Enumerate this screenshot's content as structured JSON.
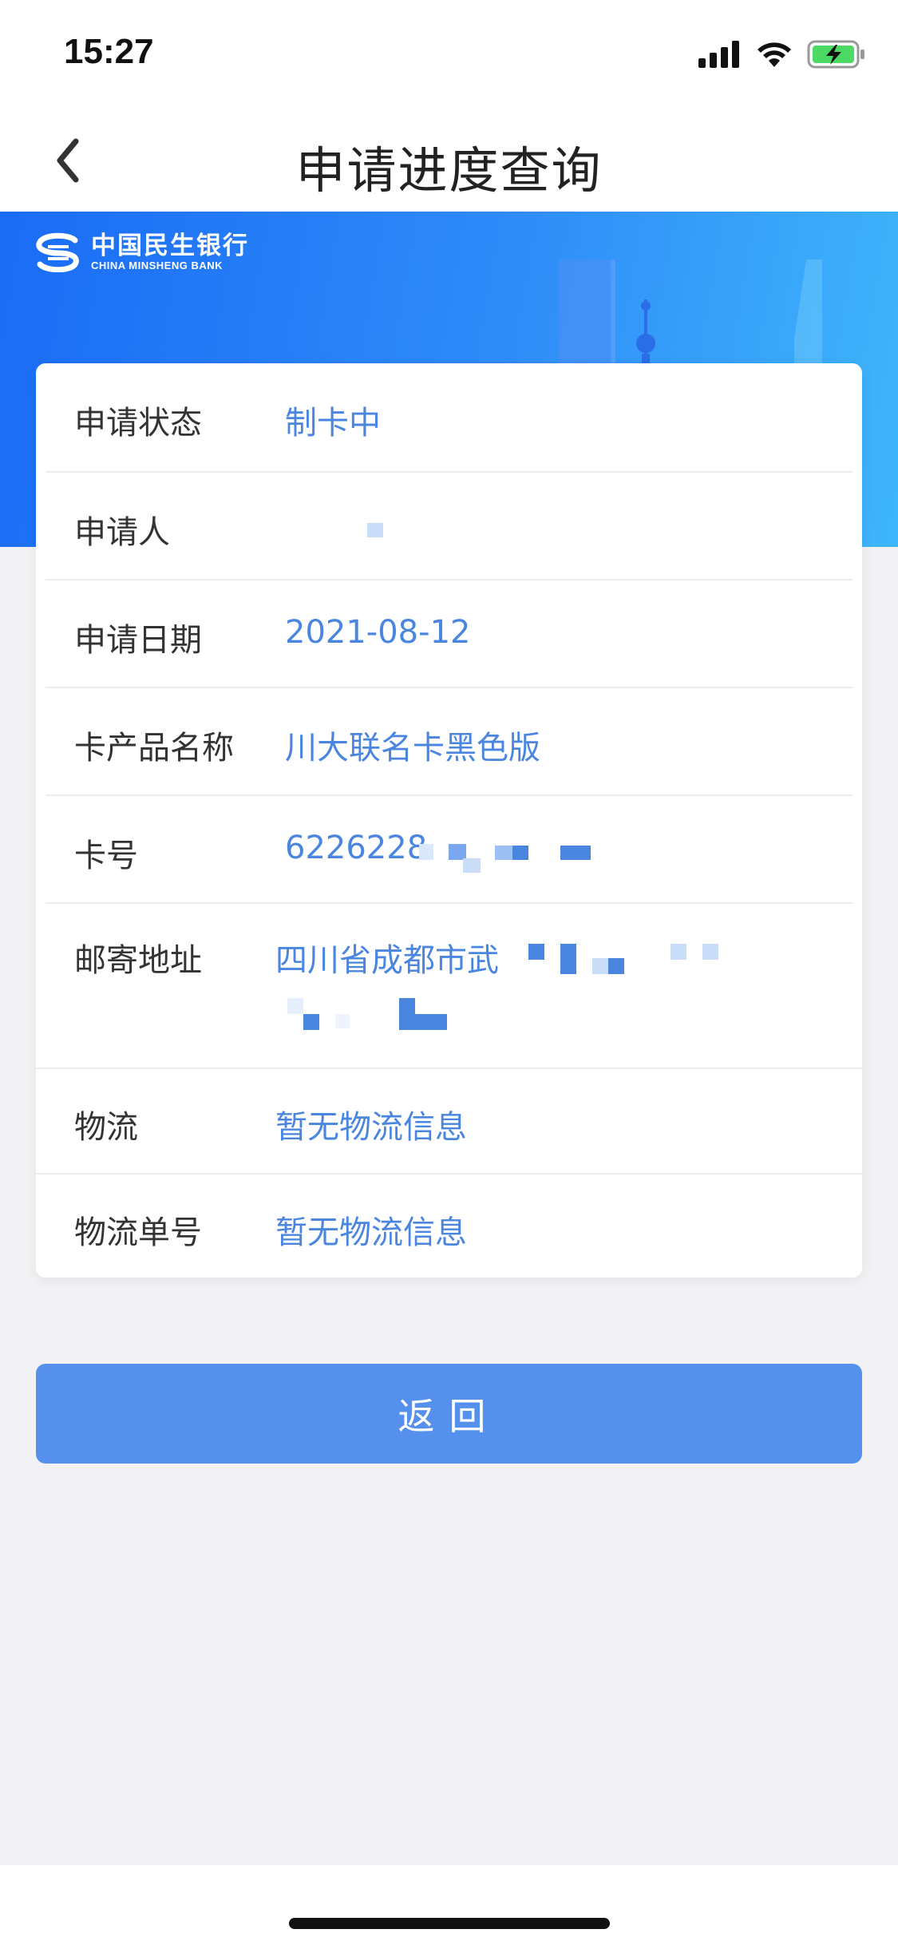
{
  "status_bar": {
    "time": "15:27",
    "icons": [
      "signal-icon",
      "wifi-icon",
      "battery-charging-icon"
    ]
  },
  "nav": {
    "back_icon": "chevron-left-icon",
    "title": "申请进度查询"
  },
  "banner": {
    "bank_name_cn": "中国民生银行",
    "bank_name_en": "CHINA MINSHENG BANK",
    "gradient": [
      "#1a6cf5",
      "#3fb6fb"
    ]
  },
  "details": {
    "status": {
      "label": "申请状态",
      "value": "制卡中"
    },
    "applicant": {
      "label": "申请人",
      "value": ""
    },
    "date": {
      "label": "申请日期",
      "value": "2021-08-12"
    },
    "product": {
      "label": "卡产品名称",
      "value": "川大联名卡黑色版"
    },
    "card_number": {
      "label": "卡号",
      "value": "6226228"
    },
    "address": {
      "label": "邮寄地址",
      "value": "四川省成都市武"
    },
    "logistics": {
      "label": "物流",
      "value": "暂无物流信息"
    },
    "tracking": {
      "label": "物流单号",
      "value": "暂无物流信息"
    }
  },
  "actions": {
    "back_label": "返回"
  },
  "colors": {
    "value_text": "#4a86e0",
    "button": "#5590ec",
    "page_bg": "#f2f2f4"
  }
}
